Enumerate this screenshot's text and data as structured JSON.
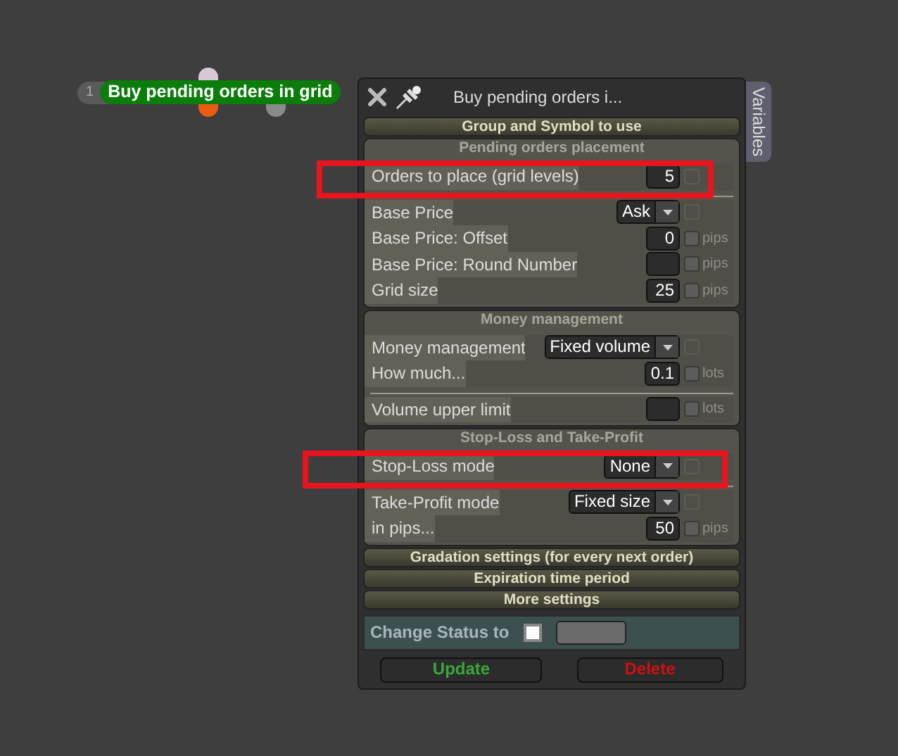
{
  "node": {
    "number": "1",
    "label": "Buy pending orders in grid"
  },
  "panel": {
    "title": "Buy pending orders i...",
    "side_tab": "Variables",
    "sections": [
      {
        "title": "Group and Symbol to use",
        "expanded": false
      },
      {
        "title": "Pending orders placement",
        "expanded": true,
        "groups": [
          [
            {
              "kind": "number",
              "label": "Orders to place (grid levels)",
              "value": "5",
              "checked": false,
              "highlighted": true
            }
          ],
          [
            {
              "kind": "select",
              "label": "Base Price",
              "value": "Ask",
              "checked": false,
              "highlighted": false
            },
            {
              "kind": "number",
              "label": "Base Price: Offset",
              "value": "0",
              "unit": "pips",
              "checked": false,
              "highlighted": false
            },
            {
              "kind": "number",
              "label": "Base Price: Round Number",
              "unit": "pips",
              "checked": false,
              "highlighted": false
            },
            {
              "kind": "number",
              "label": "Grid size",
              "value": "25",
              "unit": "pips",
              "checked": false,
              "highlighted": false
            }
          ]
        ]
      },
      {
        "title": "Money management",
        "expanded": true,
        "groups": [
          [
            {
              "kind": "select",
              "label": "Money management",
              "value": "Fixed volume",
              "checked": false,
              "highlighted": false
            },
            {
              "kind": "number",
              "label": "How much...",
              "value": "0.1",
              "unit": "lots",
              "checked": false,
              "highlighted": false
            }
          ],
          [
            {
              "kind": "number",
              "label": "Volume upper limit",
              "unit": "lots",
              "checked": false,
              "highlighted": false
            }
          ]
        ]
      },
      {
        "title": "Stop-Loss and Take-Profit",
        "expanded": true,
        "groups": [
          [
            {
              "kind": "select",
              "label": "Stop-Loss mode",
              "value": "None",
              "checked": false,
              "highlighted": true
            }
          ],
          [
            {
              "kind": "select",
              "label": "Take-Profit mode",
              "value": "Fixed size",
              "checked": false,
              "highlighted": false
            },
            {
              "kind": "number",
              "label": "in pips...",
              "value": "50",
              "unit": "pips",
              "checked": false,
              "highlighted": false
            }
          ]
        ]
      },
      {
        "title": "Gradation settings (for every next order)",
        "expanded": false
      },
      {
        "title": "Expiration time period",
        "expanded": false
      },
      {
        "title": "More settings",
        "expanded": false
      }
    ],
    "status": {
      "label": "Change Status to",
      "checked": false
    },
    "buttons": [
      {
        "label": "Update",
        "kind": "update"
      },
      {
        "label": "Delete",
        "kind": "delete"
      }
    ]
  }
}
